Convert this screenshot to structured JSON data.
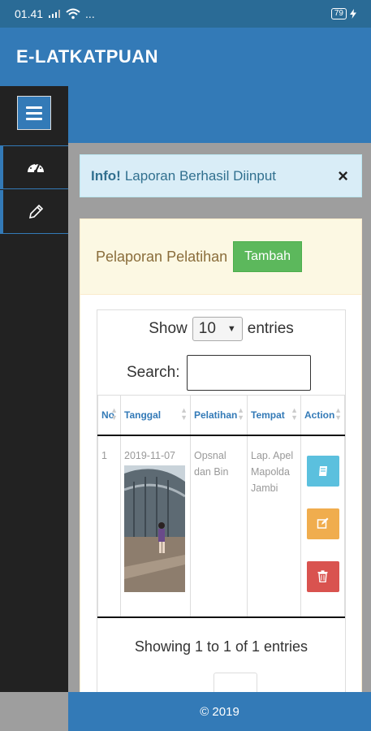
{
  "status": {
    "time": "01.41",
    "network": "...",
    "battery": "79"
  },
  "app": {
    "title": "E-LATKATPUAN"
  },
  "sidebar": {
    "items": [
      {
        "icon": "dashboard-icon"
      },
      {
        "icon": "pencil-icon"
      }
    ]
  },
  "alert": {
    "strong": "Info!",
    "message": "Laporan Berhasil Diinput",
    "close": "×"
  },
  "panel": {
    "title": "Pelaporan Pelatihan",
    "add_button": "Tambah"
  },
  "datatable": {
    "show_label": "Show",
    "entries_label": "entries",
    "page_length": "10",
    "search_label": "Search:",
    "columns": [
      "No",
      "Tanggal",
      "Pelatihan",
      "Tempat",
      "Action"
    ],
    "rows": [
      {
        "no": "1",
        "tanggal": "2019-11-07",
        "pelatihan": "Opsnal dan Bin",
        "tempat": "Lap. Apel Mapolda Jambi"
      }
    ],
    "info": "Showing 1 to 1 of 1 entries"
  },
  "footer": {
    "text": "© 2019"
  },
  "colors": {
    "primary": "#337ab7",
    "success": "#5cb85c",
    "info": "#5bc0de",
    "warning": "#f0ad4e",
    "danger": "#d9534f"
  }
}
